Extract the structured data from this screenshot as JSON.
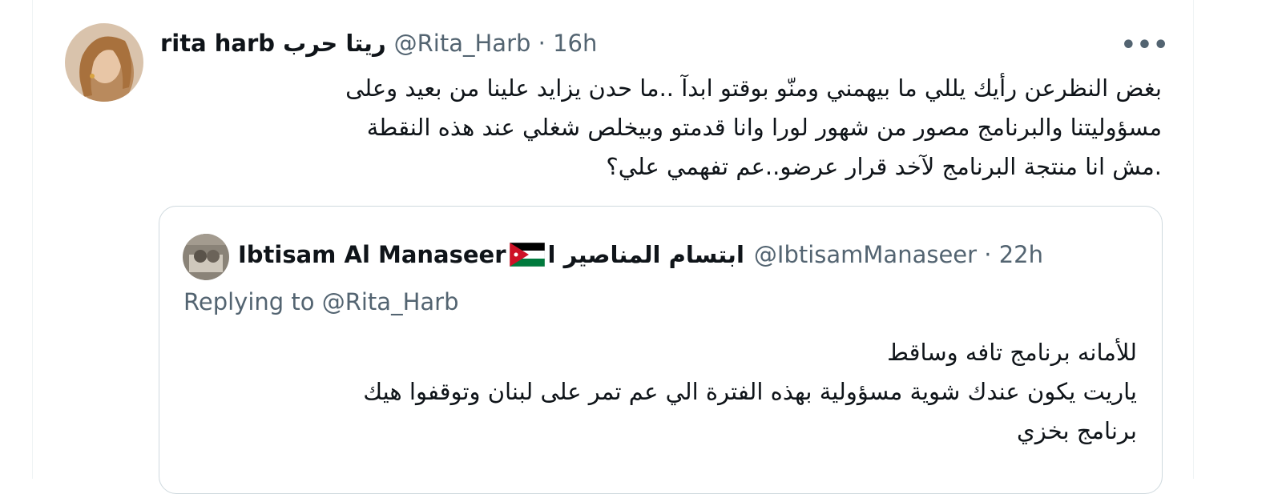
{
  "tweet": {
    "display_name": "rita harb ريتا حرب",
    "handle_time": "@Rita_Harb · 16h",
    "more_label": "•••",
    "text_lines": [
      "بغض النظرعن رأيك يللي ما بيهمني ومنّو  بوقتو ابدآ ..ما حدن يزايد علينا من بعيد وعلى",
      "مسؤوليتنا والبرنامج مصور من شهور لورا وانا قدمتو وبيخلص شغلي عند هذه النقطة",
      ".مش انا منتجة البرنامج لآخد قرار عرضو..عم تفهمي علي؟"
    ]
  },
  "quote": {
    "display_name": "Ibtisam Al Manaseer",
    "display_name_ar": "ابتسام المناصير ا",
    "handle_time": "@IbtisamManaseer · 22h",
    "replying_label": "Replying to",
    "replying_mention": "@Rita_Harb",
    "text_lines": [
      "للأمانه برنامج تافه وساقط",
      "ياريت يكون عندك شوية مسؤولية بهذه الفترة الي عم تمر على لبنان وتوقفوا هيك",
      "برنامج بخزي"
    ]
  },
  "icons": {
    "flag": "jordan-flag-icon",
    "more": "more-icon"
  },
  "colors": {
    "text": "#0f1419",
    "secondary": "#536471",
    "border": "#cfd9de"
  }
}
